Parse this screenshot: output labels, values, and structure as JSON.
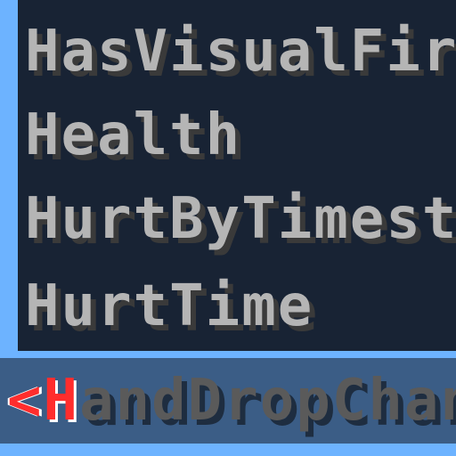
{
  "list": {
    "items": [
      {
        "label": "HasVisualFire"
      },
      {
        "label": "Health"
      },
      {
        "label": "HurtByTimestamp"
      },
      {
        "label": "HurtTime"
      }
    ],
    "selected": {
      "caret": "<",
      "first_letter": "H",
      "rest": "andDropChances"
    }
  },
  "colors": {
    "background": "#6db3ff",
    "panel": "#182334",
    "selected_row": "#3b5d86",
    "text": "#b5b5b5",
    "highlight": "#ff2d2d"
  }
}
